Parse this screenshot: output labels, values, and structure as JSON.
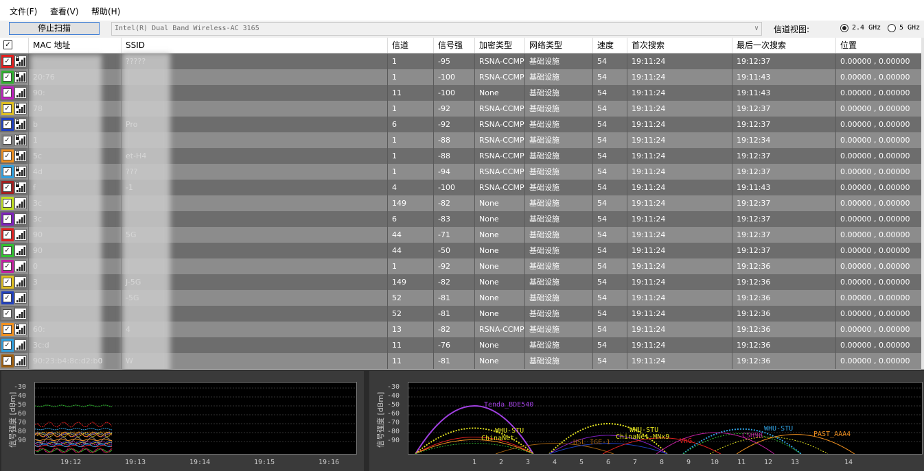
{
  "menu": [
    {
      "label": "文件(F)",
      "x": 14
    },
    {
      "label": "查看(V)",
      "x": 73
    },
    {
      "label": "帮助(H)",
      "x": 133
    }
  ],
  "toolbar": {
    "scan_button": "停止扫描",
    "adapter": "Intel(R) Dual Band Wireless-AC 3165",
    "channel_view_label": "信道视图:",
    "band_24": "2.4 GHz",
    "band_5": "5 GHz",
    "selected_band": "2.4 GHz"
  },
  "table": {
    "columns": [
      "MAC 地址",
      "SSID",
      "信道",
      "信号强",
      "加密类型",
      "网络类型",
      "速度",
      "首次搜索",
      "最后一次搜索",
      "位置"
    ],
    "rows": [
      {
        "color": "#e02020",
        "mac": "",
        "ssid": "?????",
        "channel": "1",
        "signal": "-95",
        "enc": "RSNA-CCMP",
        "type": "基础设施",
        "speed": "54",
        "first": "19:11:24",
        "last": "19:12:37",
        "pos": "0.00000 , 0.00000",
        "lock": true
      },
      {
        "color": "#30b030",
        "mac": "20:76",
        "ssid": "",
        "channel": "1",
        "signal": "-100",
        "enc": "RSNA-CCMP",
        "type": "基础设施",
        "speed": "54",
        "first": "19:11:24",
        "last": "19:11:43",
        "pos": "0.00000 , 0.00000",
        "lock": true
      },
      {
        "color": "#c020c0",
        "mac": "90:",
        "ssid": "",
        "channel": "11",
        "signal": "-100",
        "enc": "None",
        "type": "基础设施",
        "speed": "54",
        "first": "19:11:24",
        "last": "19:11:43",
        "pos": "0.00000 , 0.00000",
        "lock": false
      },
      {
        "color": "#e0c020",
        "mac": "78",
        "ssid": "",
        "channel": "1",
        "signal": "-92",
        "enc": "RSNA-CCMP",
        "type": "基础设施",
        "speed": "54",
        "first": "19:11:24",
        "last": "19:12:37",
        "pos": "0.00000 , 0.00000",
        "lock": true
      },
      {
        "color": "#2040c0",
        "mac": "b",
        "ssid": "Pro",
        "channel": "6",
        "signal": "-92",
        "enc": "RSNA-CCMP",
        "type": "基础设施",
        "speed": "54",
        "first": "19:11:24",
        "last": "19:12:37",
        "pos": "0.00000 , 0.00000",
        "lock": true
      },
      {
        "color": "#808080",
        "mac": "1",
        "ssid": "",
        "channel": "1",
        "signal": "-88",
        "enc": "RSNA-CCMP",
        "type": "基础设施",
        "speed": "54",
        "first": "19:11:24",
        "last": "19:12:34",
        "pos": "0.00000 , 0.00000",
        "lock": true
      },
      {
        "color": "#f09020",
        "mac": "5c",
        "ssid": "et-H4",
        "channel": "1",
        "signal": "-88",
        "enc": "RSNA-CCMP",
        "type": "基础设施",
        "speed": "54",
        "first": "19:11:24",
        "last": "19:12:37",
        "pos": "0.00000 , 0.00000",
        "lock": true
      },
      {
        "color": "#30a0e0",
        "mac": "4d",
        "ssid": "???",
        "channel": "1",
        "signal": "-94",
        "enc": "RSNA-CCMP",
        "type": "基础设施",
        "speed": "54",
        "first": "19:11:24",
        "last": "19:12:37",
        "pos": "0.00000 , 0.00000",
        "lock": true
      },
      {
        "color": "#a02020",
        "mac": "f",
        "ssid": "-1",
        "channel": "4",
        "signal": "-100",
        "enc": "RSNA-CCMP",
        "type": "基础设施",
        "speed": "54",
        "first": "19:11:24",
        "last": "19:11:43",
        "pos": "0.00000 , 0.00000",
        "lock": true
      },
      {
        "color": "#c0e020",
        "mac": "3c",
        "ssid": "",
        "channel": "149",
        "signal": "-82",
        "enc": "None",
        "type": "基础设施",
        "speed": "54",
        "first": "19:11:24",
        "last": "19:12:37",
        "pos": "0.00000 , 0.00000",
        "lock": false
      },
      {
        "color": "#8020c0",
        "mac": "3c",
        "ssid": "",
        "channel": "6",
        "signal": "-83",
        "enc": "None",
        "type": "基础设施",
        "speed": "54",
        "first": "19:11:24",
        "last": "19:12:37",
        "pos": "0.00000 , 0.00000",
        "lock": false
      },
      {
        "color": "#e02020",
        "mac": "90",
        "ssid": "5G",
        "channel": "44",
        "signal": "-71",
        "enc": "None",
        "type": "基础设施",
        "speed": "54",
        "first": "19:11:24",
        "last": "19:12:37",
        "pos": "0.00000 , 0.00000",
        "lock": false
      },
      {
        "color": "#30c030",
        "mac": "90",
        "ssid": "",
        "channel": "44",
        "signal": "-50",
        "enc": "None",
        "type": "基础设施",
        "speed": "54",
        "first": "19:11:24",
        "last": "19:12:37",
        "pos": "0.00000 , 0.00000",
        "lock": false
      },
      {
        "color": "#c020a0",
        "mac": "0",
        "ssid": "",
        "channel": "1",
        "signal": "-92",
        "enc": "None",
        "type": "基础设施",
        "speed": "54",
        "first": "19:11:24",
        "last": "19:12:36",
        "pos": "0.00000 , 0.00000",
        "lock": false
      },
      {
        "color": "#e0c020",
        "mac": "3",
        "ssid": "J-5G",
        "channel": "149",
        "signal": "-82",
        "enc": "None",
        "type": "基础设施",
        "speed": "54",
        "first": "19:11:24",
        "last": "19:12:36",
        "pos": "0.00000 , 0.00000",
        "lock": false
      },
      {
        "color": "#2040c0",
        "mac": "",
        "ssid": "-5G",
        "channel": "52",
        "signal": "-81",
        "enc": "None",
        "type": "基础设施",
        "speed": "54",
        "first": "19:11:24",
        "last": "19:12:36",
        "pos": "0.00000 , 0.00000",
        "lock": false
      },
      {
        "color": "#808080",
        "mac": "",
        "ssid": "",
        "channel": "52",
        "signal": "-81",
        "enc": "None",
        "type": "基础设施",
        "speed": "54",
        "first": "19:11:24",
        "last": "19:12:36",
        "pos": "0.00000 , 0.00000",
        "lock": false
      },
      {
        "color": "#f09020",
        "mac": "60:",
        "ssid": "4",
        "channel": "13",
        "signal": "-82",
        "enc": "RSNA-CCMP",
        "type": "基础设施",
        "speed": "54",
        "first": "19:11:24",
        "last": "19:12:36",
        "pos": "0.00000 , 0.00000",
        "lock": true
      },
      {
        "color": "#30a0e0",
        "mac": "3c:d",
        "ssid": "",
        "channel": "11",
        "signal": "-76",
        "enc": "None",
        "type": "基础设施",
        "speed": "54",
        "first": "19:11:24",
        "last": "19:12:36",
        "pos": "0.00000 , 0.00000",
        "lock": false
      },
      {
        "color": "#a06010",
        "mac": "90:23:b4:8c:d2:b0",
        "ssid": "W",
        "channel": "11",
        "signal": "-81",
        "enc": "None",
        "type": "基础设施",
        "speed": "54",
        "first": "19:11:24",
        "last": "19:12:36",
        "pos": "0.00000 , 0.00000",
        "lock": false
      }
    ]
  },
  "time_graph": {
    "ylabel": "信号强度 [dBm]",
    "yticks": [
      "-30",
      "-40",
      "-50",
      "-60",
      "-70",
      "-80",
      "-90"
    ],
    "xticks": [
      "19:12",
      "19:13",
      "19:14",
      "19:15",
      "19:16"
    ]
  },
  "channel_graph": {
    "ylabel": "信号强度 [dBm]",
    "yticks": [
      "-30",
      "-40",
      "-50",
      "-60",
      "-70",
      "-80",
      "-90"
    ],
    "xticks": [
      "1",
      "2",
      "3",
      "4",
      "5",
      "6",
      "7",
      "8",
      "9",
      "10",
      "11",
      "12",
      "13",
      "14"
    ],
    "labels": [
      {
        "text": "Tenda_BDE540",
        "color": "#a040e0"
      },
      {
        "text": "WHU-STU",
        "color": "#e0e020"
      },
      {
        "text": "ChinaNet-",
        "color": "#e0e020"
      },
      {
        "text": "HSL_IGE-1",
        "color": "#a06010"
      },
      {
        "text": "WHU-STU",
        "color": "#e0e020"
      },
      {
        "text": "ChinaNet-MNx9",
        "color": "#e0e020"
      },
      {
        "text": "VnG",
        "color": "#e02020"
      },
      {
        "text": "CSH98",
        "color": "#c020a0"
      },
      {
        "text": "WHU-STU",
        "color": "#30a0e0"
      },
      {
        "text": "PAST_AAA4",
        "color": "#f09020"
      }
    ]
  },
  "colors": {
    "row_dark": "#6d6d6d",
    "row_light": "#8c8c8c",
    "graph_bg": "#000000"
  }
}
